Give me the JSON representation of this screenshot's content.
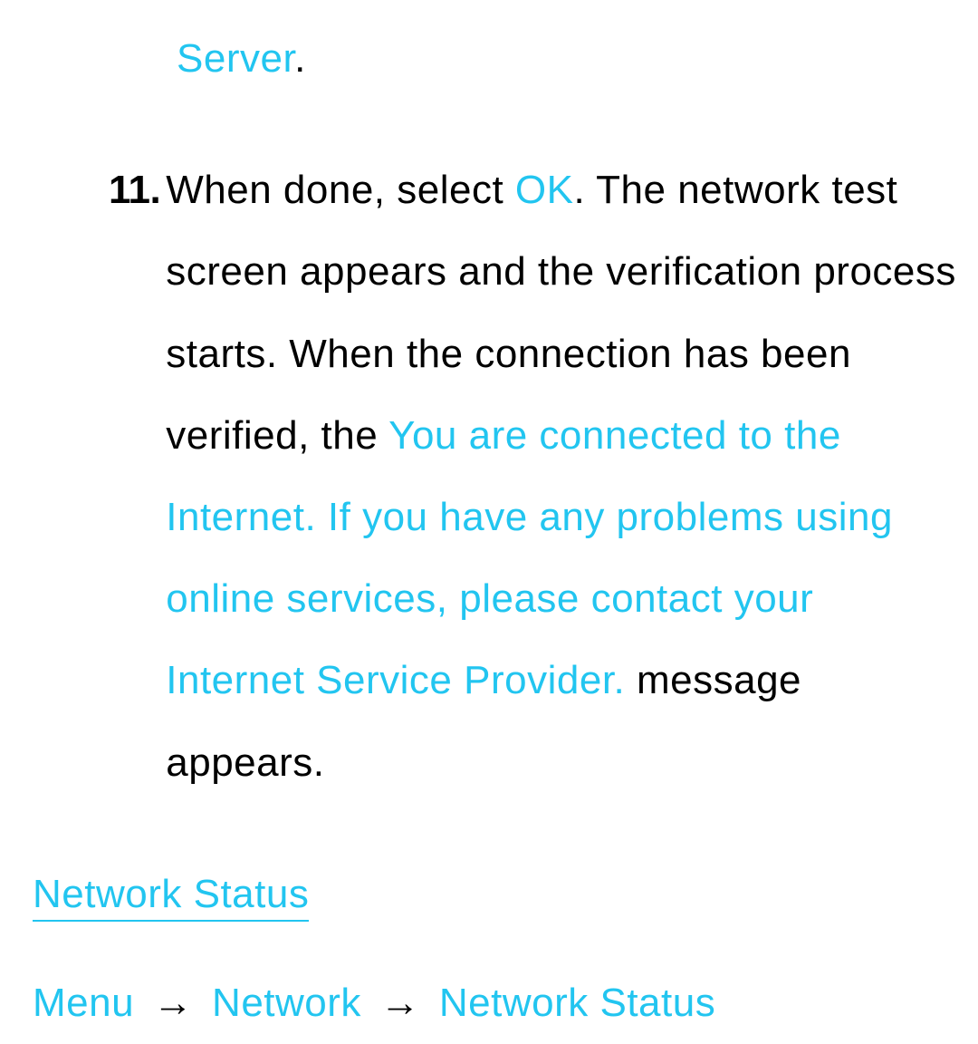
{
  "fragment": {
    "dns_server": "Server"
  },
  "step11": {
    "number": "11.",
    "text_before_ok": "When done, select ",
    "ok_label": "OK",
    "text_after_ok": ". The network test screen appears and the verification process starts. When the connection has been verified, the ",
    "connected_msg": "You are connected to the Internet. If you have any problems using online services, please contact your Internet Service Provider.",
    "text_after_msg": " message appears."
  },
  "section": {
    "heading": "Network Status",
    "nav": {
      "menu": "Menu",
      "network": "Network",
      "network_status": "Network Status",
      "arrow": "→"
    }
  }
}
